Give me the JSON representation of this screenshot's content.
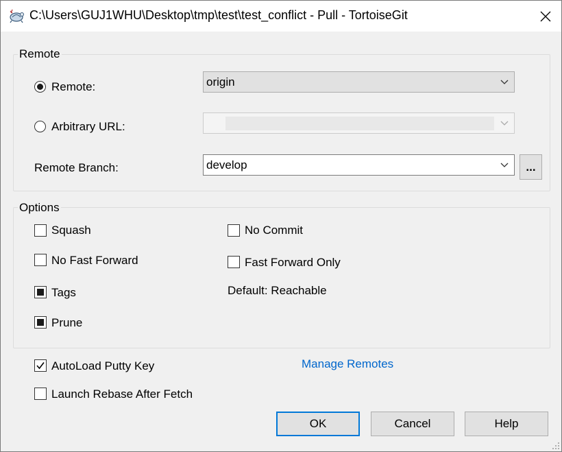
{
  "window": {
    "title": "C:\\Users\\GUJ1WHU\\Desktop\\tmp\\test\\test_conflict - Pull - TortoiseGit"
  },
  "remote_group": {
    "label": "Remote",
    "remote_radio": {
      "label": "Remote:",
      "checked": true
    },
    "remote_combo": {
      "value": "origin"
    },
    "url_radio": {
      "label": "Arbitrary URL:",
      "checked": false
    },
    "url_combo": {
      "value": ""
    },
    "branch_label": "Remote Branch:",
    "branch_combo": {
      "value": "develop"
    },
    "browse_button": "..."
  },
  "options_group": {
    "label": "Options",
    "squash": {
      "label": "Squash",
      "checked": false
    },
    "no_fast_forward": {
      "label": "No Fast Forward",
      "checked": false
    },
    "tags": {
      "label": "Tags",
      "state": "indeterminate"
    },
    "prune": {
      "label": "Prune",
      "state": "indeterminate"
    },
    "no_commit": {
      "label": "No Commit",
      "checked": false
    },
    "fast_forward_only": {
      "label": "Fast Forward Only",
      "checked": false
    },
    "default_text": "Default: Reachable"
  },
  "autoload_putty": {
    "label": "AutoLoad Putty Key",
    "checked": true
  },
  "launch_rebase": {
    "label": "Launch Rebase After Fetch",
    "checked": false
  },
  "manage_remotes_link": "Manage Remotes",
  "buttons": {
    "ok": "OK",
    "cancel": "Cancel",
    "help": "Help"
  },
  "colors": {
    "accent": "#0078d7",
    "link": "#0066cc",
    "dialog_bg": "#f0f0f0"
  },
  "icons": {
    "app": "tortoisegit-icon",
    "close": "close-icon",
    "dropdown": "chevron-down-icon"
  }
}
